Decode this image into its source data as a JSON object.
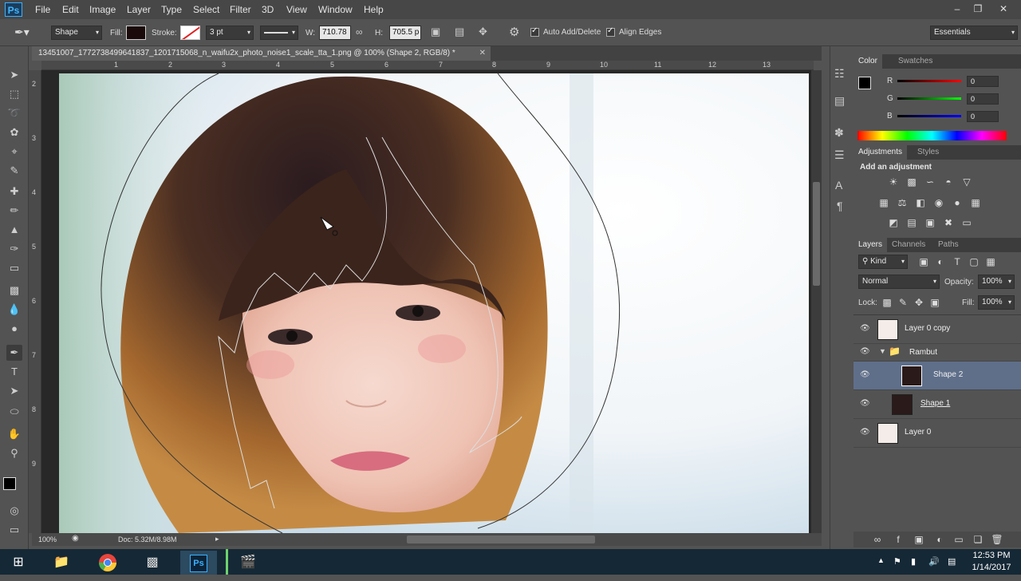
{
  "app": {
    "logo": "Ps"
  },
  "menu": [
    "File",
    "Edit",
    "Image",
    "Layer",
    "Type",
    "Select",
    "Filter",
    "3D",
    "View",
    "Window",
    "Help"
  ],
  "options": {
    "mode": "Shape",
    "fill_label": "Fill:",
    "stroke_label": "Stroke:",
    "stroke_width": "3 pt",
    "w_label": "W:",
    "w_value": "710.78",
    "h_label": "H:",
    "h_value": "705.5 p",
    "auto_add_delete": "Auto Add/Delete",
    "align_edges": "Align Edges",
    "workspace": "Essentials"
  },
  "document": {
    "tab_title": "13451007_1772738499641837_1201715068_n_waifu2x_photo_noise1_scale_tta_1.png @ 100% (Shape 2, RGB/8) *",
    "zoom": "100%",
    "doc_info": "Doc: 5.32M/8.98M"
  },
  "ruler": {
    "top": [
      "1",
      "2",
      "3",
      "4",
      "5",
      "6",
      "7",
      "8",
      "9",
      "10",
      "11",
      "12",
      "13"
    ],
    "left": [
      "2",
      "3",
      "4",
      "5",
      "6",
      "7",
      "8",
      "9"
    ]
  },
  "color_panel": {
    "tabs": [
      "Color",
      "Swatches"
    ],
    "r_label": "R",
    "g_label": "G",
    "b_label": "B",
    "r": "0",
    "g": "0",
    "b": "0"
  },
  "adjustments_panel": {
    "tabs": [
      "Adjustments",
      "Styles"
    ],
    "heading": "Add an adjustment"
  },
  "layers_panel": {
    "tabs": [
      "Layers",
      "Channels",
      "Paths"
    ],
    "filter": "Kind",
    "blend_mode": "Normal",
    "opacity_label": "Opacity:",
    "opacity": "100%",
    "lock_label": "Lock:",
    "fill_label": "Fill:",
    "fill": "100%",
    "layers": [
      {
        "name": "Layer 0 copy"
      },
      {
        "name": "Rambut"
      },
      {
        "name": "Shape 2"
      },
      {
        "name": "Shape 1"
      },
      {
        "name": "Layer 0"
      }
    ]
  },
  "taskbar": {
    "time": "12:53 PM",
    "date": "1/14/2017",
    "ps_label": "Ps"
  },
  "colors": {
    "accent": "#3ab0ff",
    "selected_layer": "#5f6f8a",
    "taskbar": "#152836"
  }
}
